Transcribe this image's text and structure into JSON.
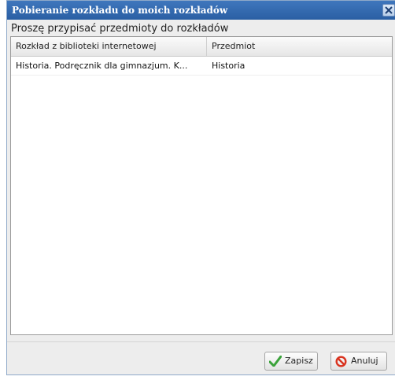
{
  "dialog": {
    "title": "Pobieranie rozkładu do moich rozkładów",
    "prompt": "Proszę przypisać przedmioty do rozkładów"
  },
  "grid": {
    "columns": [
      "Rozkład z biblioteki internetowej",
      "Przedmiot"
    ],
    "rows": [
      {
        "schedule": "Historia. Podręcznik dla gimnazjum. K...",
        "subject": "Historia"
      }
    ]
  },
  "buttons": {
    "save_label": "Zapisz",
    "cancel_label": "Anuluj"
  },
  "colors": {
    "titlebar": "#2f66ab",
    "save_icon": "#3aa23a",
    "cancel_icon": "#d9331f"
  }
}
